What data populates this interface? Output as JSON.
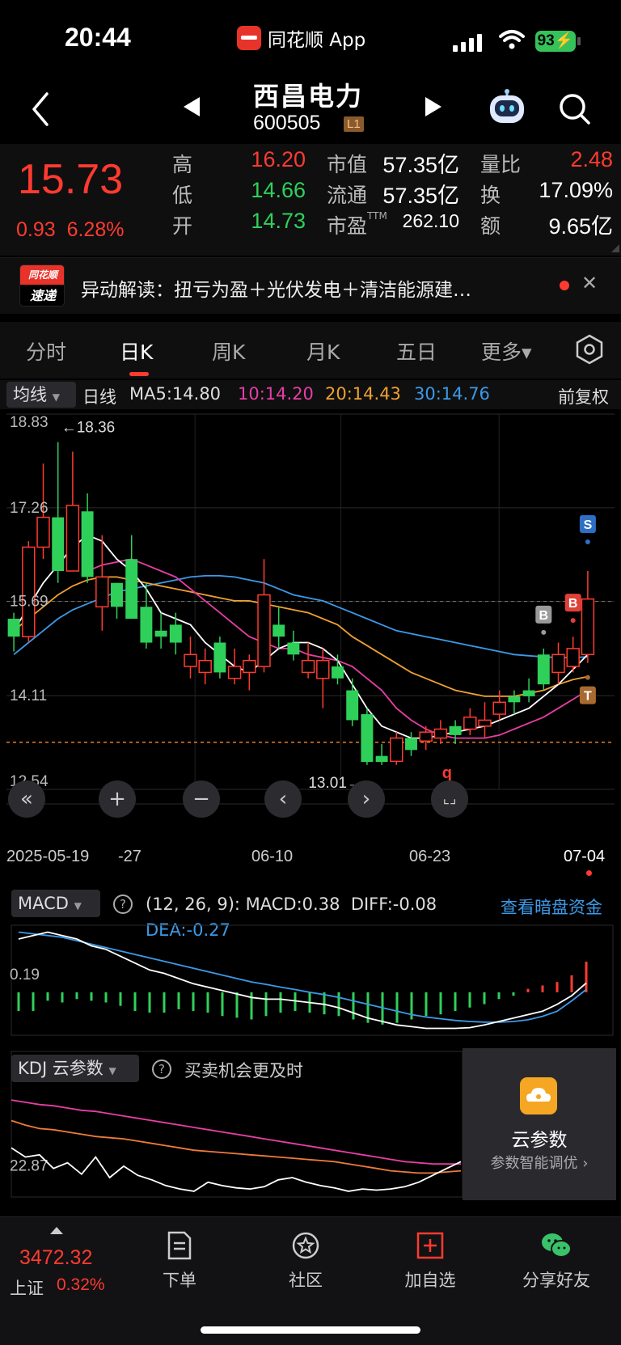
{
  "status_bar": {
    "time": "20:44",
    "app_name": "同花顺 App",
    "battery": "93"
  },
  "header": {
    "stock_name": "西昌电力",
    "stock_code": "600505",
    "level": "L1"
  },
  "quote": {
    "price": "15.73",
    "change": "0.93",
    "change_pct": "6.28%",
    "high_label": "高",
    "high": "16.20",
    "low_label": "低",
    "low": "14.66",
    "open_label": "开",
    "open": "14.73",
    "mcap_label": "市值",
    "mcap": "57.35亿",
    "float_label": "流通",
    "float": "57.35亿",
    "pe_label": "市盈",
    "pe_sup": "TTM",
    "pe": "262.10",
    "vr_label": "量比",
    "vr": "2.48",
    "turn_label": "换",
    "turn": "17.09%",
    "amt_label": "额",
    "amt": "9.65亿"
  },
  "news": {
    "logo_top": "同花顺",
    "logo_bottom": "速递",
    "text": "异动解读：扭亏为盈＋光伏发电＋清洁能源建…"
  },
  "tabs": [
    {
      "label": "分时"
    },
    {
      "label": "日K"
    },
    {
      "label": "周K"
    },
    {
      "label": "月K"
    },
    {
      "label": "五日"
    },
    {
      "label": "更多▾"
    }
  ],
  "ma_row": {
    "select": "均线",
    "period": "日线",
    "ma5": "MA5:14.80",
    "ma10": "10:14.20",
    "ma20": "20:14.43",
    "ma30": "30:14.76",
    "adjust": "前复权"
  },
  "colors": {
    "up": "#ff3b30",
    "down": "#2fd05a",
    "ma5": "#ffffff",
    "ma10": "#e83ea5",
    "ma20": "#f0a030",
    "ma30": "#3c9ae8"
  },
  "chart_data": {
    "type": "candlestick",
    "y_ticks": [
      "18.83",
      "17.26",
      "15.69",
      "14.11",
      "12.54"
    ],
    "ylim": [
      12.54,
      18.83
    ],
    "x_labels": [
      "2025-05-19",
      "-27",
      "06-10",
      "06-23",
      "07-04"
    ],
    "high_mark": "←18.36",
    "low_mark": "13.01→",
    "ref_price": 15.69,
    "last_close": 13.33,
    "candles": [
      [
        15.4,
        15.1,
        15.5,
        14.85
      ],
      [
        15.1,
        16.6,
        16.7,
        15.0
      ],
      [
        16.6,
        17.1,
        18.0,
        16.4
      ],
      [
        17.1,
        16.2,
        18.36,
        16.0
      ],
      [
        16.2,
        17.3,
        18.2,
        16.5
      ],
      [
        17.2,
        16.1,
        17.5,
        16.0
      ],
      [
        15.6,
        16.1,
        16.8,
        15.2
      ],
      [
        16.0,
        15.6,
        16.0,
        15.4
      ],
      [
        16.4,
        15.4,
        16.8,
        15.4
      ],
      [
        15.6,
        15.0,
        16.0,
        14.9
      ],
      [
        15.2,
        15.1,
        15.5,
        14.9
      ],
      [
        15.3,
        15.0,
        15.5,
        14.8
      ],
      [
        14.6,
        14.8,
        15.1,
        14.4
      ],
      [
        14.5,
        14.7,
        14.9,
        14.3
      ],
      [
        15.0,
        14.5,
        15.1,
        14.4
      ],
      [
        14.4,
        14.6,
        14.9,
        14.3
      ],
      [
        14.5,
        14.7,
        14.8,
        14.2
      ],
      [
        14.6,
        15.8,
        16.4,
        14.5
      ],
      [
        15.3,
        15.1,
        15.6,
        14.9
      ],
      [
        15.0,
        14.8,
        15.2,
        14.7
      ],
      [
        14.5,
        14.7,
        15.0,
        14.4
      ],
      [
        14.4,
        14.7,
        14.9,
        13.9
      ],
      [
        14.6,
        14.4,
        14.8,
        14.3
      ],
      [
        14.2,
        13.7,
        14.4,
        13.6
      ],
      [
        13.8,
        13.0,
        13.9,
        12.95
      ],
      [
        13.1,
        13.0,
        13.3,
        12.95
      ],
      [
        13.01,
        13.4,
        13.5,
        12.95
      ],
      [
        13.4,
        13.2,
        13.5,
        13.1
      ],
      [
        13.35,
        13.5,
        13.6,
        13.2
      ],
      [
        13.4,
        13.55,
        13.7,
        13.3
      ],
      [
        13.6,
        13.45,
        13.7,
        13.3
      ],
      [
        13.55,
        13.75,
        13.9,
        13.45
      ],
      [
        13.6,
        13.7,
        14.0,
        13.4
      ],
      [
        13.8,
        14.0,
        14.2,
        13.7
      ],
      [
        14.1,
        14.0,
        14.2,
        13.8
      ],
      [
        14.2,
        14.1,
        14.4,
        14.0
      ],
      [
        14.8,
        14.3,
        14.9,
        14.2
      ],
      [
        14.5,
        14.8,
        15.0,
        14.3
      ],
      [
        14.6,
        14.9,
        15.1,
        14.5
      ],
      [
        14.8,
        15.73,
        16.2,
        14.66
      ]
    ],
    "ma5": [
      15.2,
      15.6,
      16.0,
      16.3,
      16.6,
      16.8,
      16.7,
      16.4,
      16.2,
      15.9,
      15.5,
      15.4,
      15.3,
      15.0,
      14.8,
      14.6,
      14.5,
      14.7,
      14.9,
      15.0,
      15.0,
      14.9,
      14.7,
      14.3,
      13.9,
      13.6,
      13.5,
      13.4,
      13.4,
      13.45,
      13.5,
      13.55,
      13.6,
      13.7,
      13.8,
      13.9,
      14.1,
      14.3,
      14.55,
      14.8
    ],
    "ma10": [
      null,
      null,
      null,
      null,
      null,
      16.2,
      16.3,
      16.35,
      16.4,
      16.3,
      16.2,
      16.1,
      15.9,
      15.7,
      15.5,
      15.3,
      15.1,
      15.0,
      14.9,
      14.9,
      14.8,
      14.75,
      14.7,
      14.6,
      14.4,
      14.2,
      13.9,
      13.7,
      13.55,
      13.45,
      13.4,
      13.4,
      13.4,
      13.45,
      13.55,
      13.65,
      13.75,
      13.9,
      14.05,
      14.2
    ],
    "ma20": [
      15.2,
      15.4,
      15.6,
      15.8,
      15.95,
      16.05,
      16.1,
      16.1,
      16.05,
      16.0,
      15.95,
      15.9,
      15.85,
      15.8,
      15.75,
      15.7,
      15.7,
      15.65,
      15.6,
      15.55,
      15.5,
      15.4,
      15.3,
      15.1,
      14.95,
      14.8,
      14.65,
      14.5,
      14.4,
      14.3,
      14.2,
      14.15,
      14.1,
      14.1,
      14.1,
      14.15,
      14.2,
      14.3,
      14.38,
      14.43
    ],
    "ma30": [
      14.8,
      15.0,
      15.2,
      15.4,
      15.55,
      15.65,
      15.75,
      15.85,
      15.9,
      15.95,
      16.0,
      16.05,
      16.1,
      16.12,
      16.12,
      16.1,
      16.05,
      16.0,
      15.9,
      15.8,
      15.75,
      15.7,
      15.6,
      15.5,
      15.4,
      15.3,
      15.2,
      15.15,
      15.1,
      15.05,
      15.0,
      14.95,
      14.9,
      14.85,
      14.8,
      14.78,
      14.76,
      14.75,
      14.75,
      14.76
    ],
    "signals": [
      {
        "label": "B",
        "index": 36,
        "color": "#9a9a9a"
      },
      {
        "label": "B",
        "index": 38,
        "color": "#e0403a"
      },
      {
        "label": "S",
        "index": 39,
        "color": "#2d6fc4"
      },
      {
        "label": "T",
        "index": 39,
        "color": "#a86a30"
      }
    ],
    "buy_marker": "q"
  },
  "macd": {
    "select": "MACD",
    "params": "(12, 26, 9):",
    "macd_value": "MACD:0.38",
    "diff": "DIFF:-0.08",
    "dea": "DEA:-0.27",
    "link": "查看暗盘资金",
    "tick": "0.19",
    "bars": [
      -0.55,
      -0.55,
      -0.25,
      -0.3,
      -0.2,
      -0.25,
      -0.3,
      -0.4,
      -0.55,
      -0.6,
      -0.6,
      -0.5,
      -0.55,
      -0.6,
      -0.7,
      -0.75,
      -0.8,
      -0.7,
      -0.6,
      -0.55,
      -0.6,
      -0.65,
      -0.7,
      -0.8,
      -0.9,
      -0.95,
      -0.9,
      -0.8,
      -0.7,
      -0.65,
      -0.55,
      -0.45,
      -0.35,
      -0.2,
      -0.1,
      0.1,
      0.2,
      0.3,
      0.5,
      0.9
    ],
    "diff_line": [
      1.2,
      1.3,
      1.4,
      1.3,
      1.2,
      1.0,
      0.9,
      0.7,
      0.5,
      0.3,
      0.2,
      0.05,
      -0.1,
      -0.2,
      -0.3,
      -0.4,
      -0.5,
      -0.55,
      -0.55,
      -0.6,
      -0.65,
      -0.7,
      -0.8,
      -0.95,
      -1.1,
      -1.2,
      -1.3,
      -1.35,
      -1.4,
      -1.4,
      -1.4,
      -1.38,
      -1.3,
      -1.2,
      -1.1,
      -1.0,
      -0.9,
      -0.7,
      -0.45,
      -0.08
    ],
    "dea_line": [
      1.4,
      1.35,
      1.3,
      1.25,
      1.15,
      1.05,
      0.95,
      0.85,
      0.75,
      0.65,
      0.55,
      0.45,
      0.35,
      0.25,
      0.15,
      0.05,
      -0.05,
      -0.12,
      -0.2,
      -0.27,
      -0.35,
      -0.42,
      -0.5,
      -0.6,
      -0.7,
      -0.8,
      -0.9,
      -1.0,
      -1.07,
      -1.12,
      -1.17,
      -1.2,
      -1.22,
      -1.22,
      -1.2,
      -1.15,
      -1.05,
      -0.9,
      -0.6,
      -0.27
    ]
  },
  "kdj": {
    "select": "KDJ 云参数",
    "desc": "买卖机会更及时",
    "tick": "22.87",
    "k": [
      62,
      58,
      55,
      54,
      52,
      50,
      48,
      47,
      46,
      44,
      42,
      40,
      38,
      36,
      35,
      34,
      33,
      32,
      31,
      30,
      29,
      28,
      27,
      26,
      24,
      22,
      20,
      18,
      17,
      16,
      16,
      17,
      18
    ],
    "d": [
      80,
      78,
      76,
      75,
      73,
      71,
      70,
      68,
      66,
      64,
      62,
      60,
      58,
      56,
      54,
      52,
      50,
      48,
      46,
      44,
      42,
      40,
      38,
      36,
      34,
      32,
      30,
      28,
      26,
      25,
      24,
      24,
      24
    ],
    "j": [
      38,
      30,
      32,
      20,
      25,
      15,
      30,
      12,
      22,
      14,
      10,
      5,
      2,
      0,
      8,
      5,
      3,
      2,
      4,
      10,
      12,
      8,
      5,
      3,
      0,
      2,
      1,
      2,
      4,
      8,
      14,
      20,
      26
    ],
    "panel_title": "云参数",
    "panel_sub": "参数智能调优 ›"
  },
  "bottom": {
    "index_value": "3472.32",
    "index_name": "上证",
    "index_pct": "0.32%",
    "items": [
      {
        "label": "下单"
      },
      {
        "label": "社区"
      },
      {
        "label": "加自选"
      },
      {
        "label": "分享好友"
      }
    ]
  }
}
